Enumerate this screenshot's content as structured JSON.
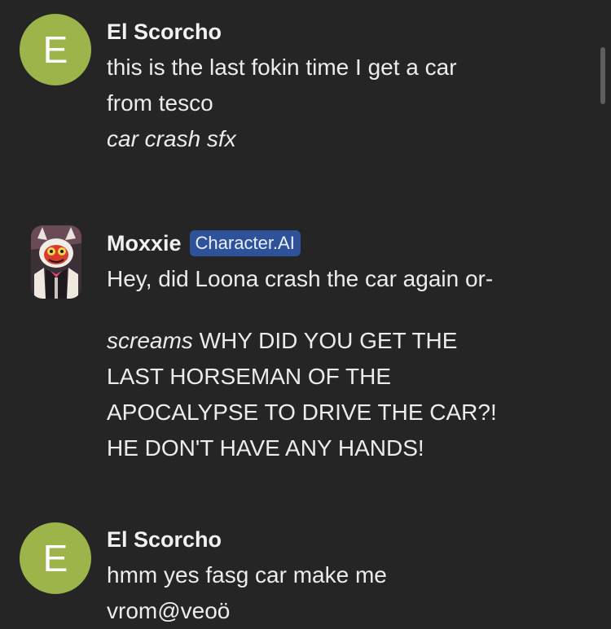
{
  "colors": {
    "background": "#252525",
    "text": "#ececec",
    "avatar_green": "#9cb44a",
    "badge_blue": "#2d5299"
  },
  "messages": [
    {
      "author": "El Scorcho",
      "avatar_letter": "E",
      "lines": [
        "this is the last fokin time I get a car",
        "from tesco"
      ],
      "action": "car crash sfx"
    },
    {
      "author": "Moxxie",
      "avatar_icon": "moxxie-character-avatar",
      "badge": "Character.AI",
      "lines": [
        "Hey, did Loona crash the car again or-"
      ],
      "action_word": "screams",
      "shout_lines": [
        "WHY DID YOU GET THE",
        "LAST HORSEMAN OF THE",
        "APOCALYPSE TO DRIVE THE CAR?!",
        "HE DON'T HAVE ANY HANDS!"
      ]
    },
    {
      "author": "El Scorcho",
      "avatar_letter": "E",
      "lines": [
        "hmm yes fasg car make me",
        "vrom@veoö"
      ]
    }
  ]
}
